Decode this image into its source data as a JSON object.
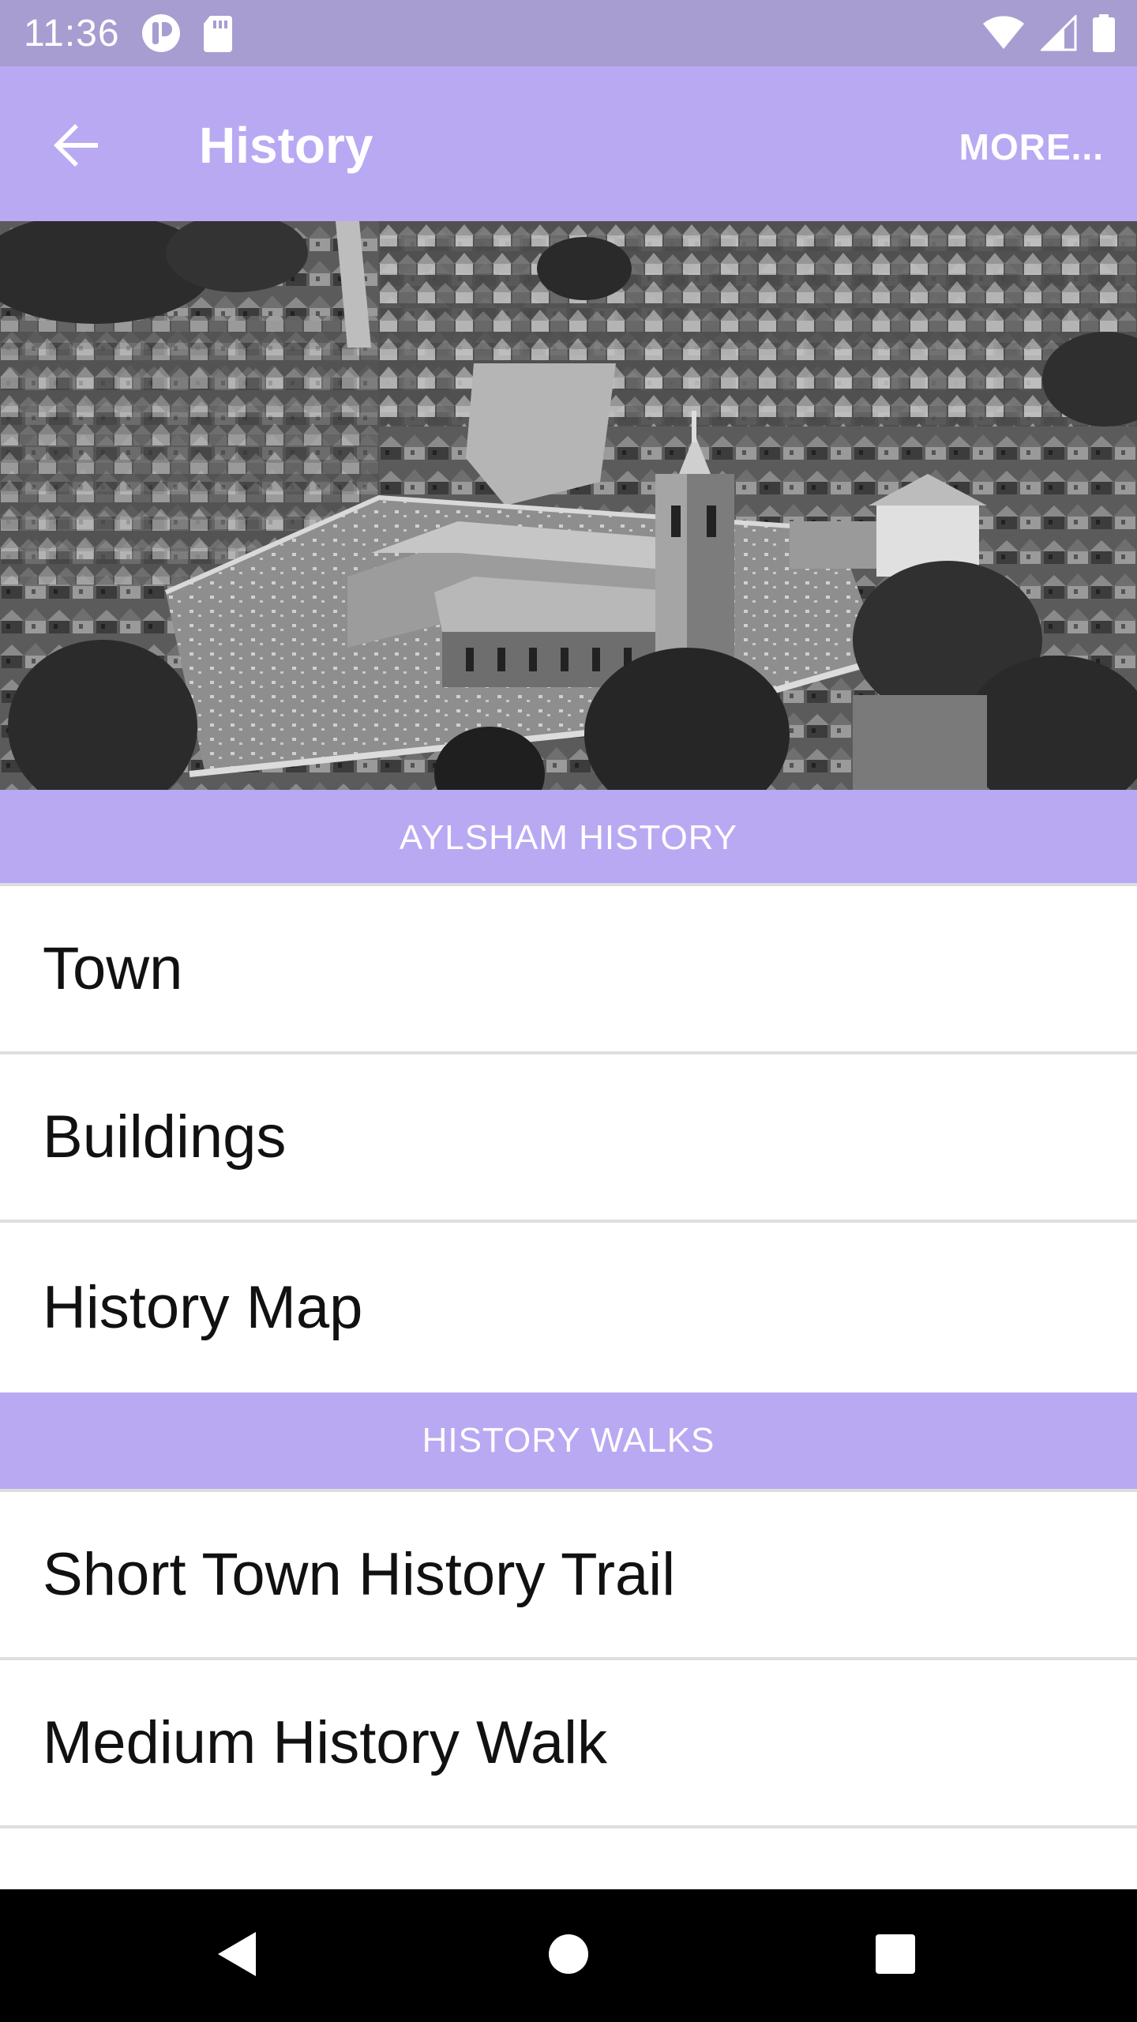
{
  "status_bar": {
    "time": "11:36",
    "icons": [
      "app-notification-icon",
      "sd-card-icon",
      "wifi-icon",
      "cellular-signal-icon",
      "battery-icon"
    ]
  },
  "app_bar": {
    "title": "History",
    "more_label": "MORE...",
    "back_icon": "arrow-back-icon",
    "background": "#b9a9f3"
  },
  "hero": {
    "description_icon": "aerial-town-photo"
  },
  "sections": [
    {
      "header": "AYLSHAM HISTORY",
      "items": [
        "Town",
        "Buildings",
        "History Map"
      ]
    },
    {
      "header": "HISTORY WALKS",
      "items": [
        "Short Town History Trail",
        "Medium History Walk"
      ]
    }
  ],
  "nav_bar": {
    "icons": [
      "back-triangle-icon",
      "home-circle-icon",
      "recents-square-icon"
    ]
  },
  "colors": {
    "status_bar": "#a79dd1",
    "accent": "#b9a9f3",
    "divider": "#dedede"
  }
}
